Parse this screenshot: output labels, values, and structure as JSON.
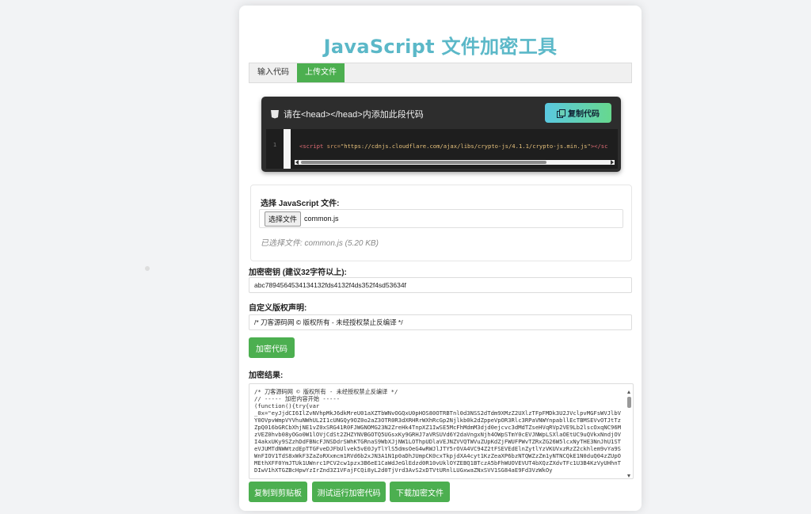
{
  "title": "JavaScript 文件加密工具",
  "tabs": [
    {
      "label": "输入代码",
      "active": false
    },
    {
      "label": "上传文件",
      "active": true
    }
  ],
  "code_panel": {
    "heading": "请在<head></head>内添加此段代码",
    "copy_button": "复制代码",
    "line_number": "1",
    "code": {
      "open_tag": "<script",
      "attr": "src=",
      "value": "\"https://cdnjs.cloudflare.com/ajax/libs/crypto-js/4.1.1/crypto-js.min.js\"",
      "close": "></sc"
    }
  },
  "file_section": {
    "label": "选择 JavaScript 文件:",
    "choose_button": "选择文件",
    "file_name": "common.js",
    "selected_info": "已选择文件: common.js (5.20 KB)"
  },
  "key_section": {
    "label": "加密密钥 (建议32字符以上):",
    "value": "abc789456453413413​2fds4132f4ds352f4sd53634f"
  },
  "copyright_section": {
    "label": "自定义版权声明:",
    "value": "/* 刀客源码网 © 版权所有 - 未经授权禁止反编译 */"
  },
  "encrypt_button": "加密代码",
  "result_section": {
    "label": "加密结果:",
    "text": "/* 刀客源码网 © 版权所有 - 未经授权禁止反编译 */\n// ----- 加密内容开始 -----\n(function(){try{var\n_0x=\"eyJjdCI6IlZvNVhpMkJ6dkMreU01aXZTbWNvOGQxU0pHOS80OTRBTnl0d3NSS2dTdm9XMzZ2UXlzTFpFMDk3U2JVclpvMGFsWVJlbVY0OVpvWmpVYVhuNWhUL2I1cUNGQy9OZ0o2aZ3OTR0R3dXRHRrWXhRcGp2Njlkb0k2dZppeVpOR3Rlc3RPaVNWYnpabllEcTBMSEVvOTJtTzZpQ016bGRCbXhjNE1vZ0xSRG41R0FJWGNOMG23N2ZreHk4TnpXZ1IwSE5McFhMdmM3djd0ejcvc3dMdTZseHVqRVp2VE9Lb2lscOxqNC96MzVEZ0hvb08yOGo0W1lOVjCdSt2ZHZYNVBGOTQ5UGsxKy9GRHJ7aVRSUVd6Y2daVngxNjh4OWpSTmY0cEVJNWpLSXlaOEtUC9uQVkxNndjOVI4akxUKy9SZzhDdFBNcFJNSDdrSWhKTGRnaS9WbXJjNW1LOThpUDlaVEJNZVVQTWVuZUpKdZjFWUFPWvTZRxZG26W5lcxNyTHE3NnJhU1STeVJUMTdNWWtzdEpTTGFveDJFbUlvek5vE0JyTlYlS5dmsOeG4wRWJlJTY5rOVA4VC94Z2tFSEVEdElnZytlYzVKUVxzRzZ2ckhlem9vYa9SWnFIOV1TdS8xWkF3ZaZoRXxmcm1RVd6b2xJN3A1N1p0aDhJUmpCK0cxTkpjdXA4cyt1KzZeaXP6bzNTQWZzZm1yNTNCQkE1N0duQ04zZUpOMEthXFF0YmJTUk1UWnrc1PCV2cw1pzx3B6eE1CaWdJeGlEdzd0R10vUklOYZEBQ1BTczA5bFhWUOVEVUT4bXQzZXdvTFc1U3B4KzVyUHhnTDIwV1hXTGZBcHpwYzIrZnd3Z1VFajFCQi8yL2d0TjVrd3AvS2xDTVtURnlLUGxwaZNxSVV1SG84aE9Fd3VzWkOy"
  },
  "bottom_buttons": [
    "复制到剪贴板",
    "测试运行加密代码",
    "下载加密文件"
  ]
}
